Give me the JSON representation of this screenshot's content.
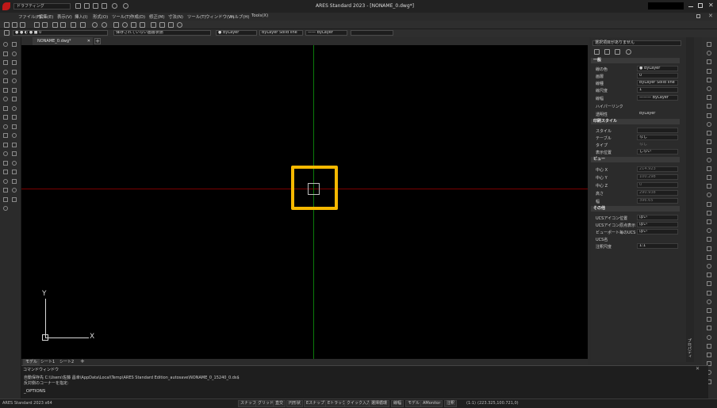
{
  "app": {
    "title": "ARES Standard 2023 - [NONAME_0.dwg*]",
    "workspace": "ドラフティング"
  },
  "menu": [
    "ファイル(F)",
    "編集(E)",
    "表示(V)",
    "挿入(I)",
    "形式(O)",
    "ツール(T)",
    "作成(D)",
    "修正(M)",
    "寸法(N)",
    "ツール(T)",
    "ウィンドウ(W)",
    "ヘルプ(H)",
    "Tools(X)"
  ],
  "layer_bar": {
    "layer": "0",
    "layer_state": "保存されていない画層状態",
    "color": "ByLayer",
    "linetype": "ByLayer",
    "lineweight_label": "Solid line",
    "lineweight": "—— ByLayer"
  },
  "doc_tab": "NONAME_0.dwg*",
  "sheet_tabs": [
    "モデル",
    "シート1",
    "シート2"
  ],
  "ucs": {
    "x": "X",
    "y": "Y"
  },
  "properties": {
    "selection": "選択項目がありません",
    "sections": [
      {
        "title": "一般",
        "rows": [
          {
            "label": "線の色",
            "value": "● ByLayer"
          },
          {
            "label": "画層",
            "value": "0"
          },
          {
            "label": "線種",
            "value": "ByLayer   Solid line"
          },
          {
            "label": "線尺度",
            "value": "1"
          },
          {
            "label": "線幅",
            "value": "——— ByLayer"
          },
          {
            "label": "ハイパーリンク",
            "value": ""
          },
          {
            "label": "透明性",
            "value": "ByLayer"
          }
        ]
      },
      {
        "title": "印刷スタイル",
        "rows": [
          {
            "label": "スタイル",
            "value": ""
          },
          {
            "label": "テーブル",
            "value": "なし"
          },
          {
            "label": "タイプ",
            "value": "なし"
          },
          {
            "label": "表示位置",
            "value": "しない"
          }
        ]
      },
      {
        "title": "ビュー",
        "rows": [
          {
            "label": "中心 X",
            "value": "214.923"
          },
          {
            "label": "中心 Y",
            "value": "100.298"
          },
          {
            "label": "中心 Z",
            "value": "0"
          },
          {
            "label": "高さ",
            "value": "290.938"
          },
          {
            "label": "幅",
            "value": "396.65"
          }
        ]
      },
      {
        "title": "その他",
        "rows": [
          {
            "label": "UCSアイコン位置",
            "value": "はい"
          },
          {
            "label": "UCSアイコン原点表示",
            "value": "はい"
          },
          {
            "label": "ビューポート毎のUCS",
            "value": "はい"
          },
          {
            "label": "UCS名",
            "value": ""
          },
          {
            "label": "注釈尺度",
            "value": "1:1"
          }
        ]
      }
    ]
  },
  "command": {
    "title": "コマンドウィンドウ",
    "line1": "自動保存先 C:\\Users\\佐藤 昌幸\\AppData\\Local\\Temp\\ARES Standard Edition_autosave\\NONAME_0_15240_0.ds$",
    "line2": "反対側のコーナーを指定:",
    "prompt": "_OPTIONS"
  },
  "status": {
    "left": "ARES Standard 2023 x64",
    "toggles": [
      "スナップ",
      "グリッド",
      "直交",
      "円形状",
      "Eスナップ",
      "Eトラック",
      "クイック入力",
      "選擇循環",
      "線幅",
      "モデル",
      "AMonitor",
      "注釈"
    ],
    "scale": "(1:1)",
    "coords": "(223.325,100.721,0)"
  },
  "colors": {
    "canvas": "#000000",
    "x_axis": "#7a0000",
    "y_axis": "#0b7a0b",
    "highlight": "#f5b800"
  },
  "right_dock_label": "プロパティ"
}
